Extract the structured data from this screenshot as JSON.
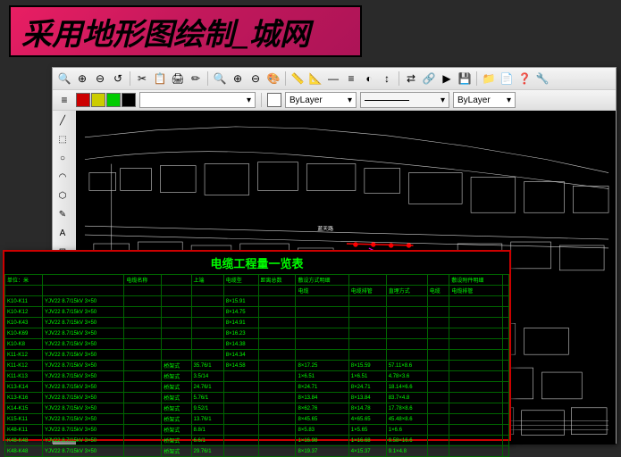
{
  "title": "采用地形图绘制_城网",
  "toolbar_icons": [
    "🔍",
    "⊕",
    "⊖",
    "↺",
    "✂",
    "📋",
    "🖨",
    "✏",
    "🔍",
    "⊕",
    "⊖",
    "🎨",
    "📏",
    "📐",
    "—",
    "≡",
    "◐",
    "↕",
    "⇄",
    "🔗",
    "▶",
    "💾",
    "📁",
    "📄",
    "❓",
    "🔧"
  ],
  "layer_bar": {
    "swatch_colors": [
      "#c00",
      "#cc0",
      "#0c0",
      "#000"
    ],
    "dropdown1": "",
    "bylayer1": "ByLayer",
    "line_dropdown": "",
    "bylayer2": "ByLayer"
  },
  "left_tools": [
    "╱",
    "⬚",
    "○",
    "◠",
    "⬡",
    "✎",
    "A",
    "⊞",
    "◈",
    "⊡",
    "▦",
    "◉",
    "⊟",
    "◫",
    "⬒",
    "⊡"
  ],
  "overlay": {
    "title": "电缆工程量一览表",
    "headers": [
      "单位：米",
      "",
      "电缆名称",
      "",
      "上端",
      "电缆型",
      "距离总数",
      "敷设方式明细",
      "",
      "",
      "",
      "敷设附件明细",
      ""
    ],
    "subheaders": [
      "",
      "",
      "",
      "",
      "",
      "",
      "",
      "电缆",
      "电缆排管",
      "直埋方式",
      "电缆",
      "电缆排管",
      ""
    ],
    "rows": [
      [
        "K10-K11",
        "YJV22 8.7/15kV 3×50",
        "",
        "",
        "",
        "8×15.91",
        "",
        "",
        "",
        "",
        "",
        "",
        ""
      ],
      [
        "K10-K12",
        "YJV22 8.7/15kV 3×50",
        "",
        "",
        "",
        "8×14.75",
        "",
        "",
        "",
        "",
        "",
        "",
        ""
      ],
      [
        "K10-K43",
        "YJV22 8.7/15kV 3×50",
        "",
        "",
        "",
        "8×14.91",
        "",
        "",
        "",
        "",
        "",
        "",
        ""
      ],
      [
        "K10-K69",
        "YJV22 8.7/15kV 3×50",
        "",
        "",
        "",
        "8×16.23",
        "",
        "",
        "",
        "",
        "",
        "",
        ""
      ],
      [
        "K10-K8",
        "YJV22 8.7/15kV 3×50",
        "",
        "",
        "",
        "8×14.38",
        "",
        "",
        "",
        "",
        "",
        "",
        ""
      ],
      [
        "K11-K12",
        "YJV22 8.7/15kV 3×50",
        "",
        "",
        "",
        "8×14.34",
        "",
        "",
        "",
        "",
        "",
        "",
        ""
      ],
      [
        "K11-K12",
        "YJV22 8.7/15kV 3×50",
        "",
        "桥架式",
        "35.76/1",
        "8×14.58",
        "",
        "8×17.25",
        "8×15.59",
        "57.11×8.6",
        "",
        "",
        ""
      ],
      [
        "K11-K13",
        "YJV22 8.7/15kV 3×50",
        "",
        "桥架式",
        "3.5/14",
        "",
        "",
        "1×6.51",
        "1×6.51",
        "4.78×3.6",
        "",
        "",
        ""
      ],
      [
        "K13-K14",
        "YJV22 8.7/15kV 3×50",
        "",
        "桥架式",
        "24.76/1",
        "",
        "",
        "8×24.71",
        "8×24.71",
        "18.14×6.6",
        "",
        "",
        ""
      ],
      [
        "K13-K16",
        "YJV22 8.7/15kV 3×50",
        "",
        "桥架式",
        "5.76/1",
        "",
        "",
        "8×13.84",
        "8×13.84",
        "83.7×4.8",
        "",
        "",
        ""
      ],
      [
        "K14-K15",
        "YJV22 8.7/15kV 3×50",
        "",
        "桥架式",
        "9.52/1",
        "",
        "",
        "8×62.76",
        "8×14.78",
        "17.78×8.6",
        "",
        "",
        ""
      ],
      [
        "K15-K11",
        "YJV22 8.7/15kV 3×50",
        "",
        "桥架式",
        "13.76/1",
        "",
        "",
        "8×45.65",
        "4×65.65",
        "45.48×8.6",
        "",
        "",
        ""
      ],
      [
        "K48-K11",
        "YJV22 8.7/15kV 3×50",
        "",
        "桥架式",
        "8.8/1",
        "",
        "",
        "8×5.83",
        "1×5.65",
        "1×6.6",
        "",
        "",
        ""
      ],
      [
        "K48-K48",
        "YJV22 8.7/15kV 3×50",
        "",
        "桥架式",
        "6.6/1",
        "",
        "",
        "1×16.98",
        "1×16.68",
        "9.58×16.6",
        "",
        "",
        ""
      ],
      [
        "K48-K48",
        "YJV22 8.7/15kV 3×50",
        "",
        "桥架式",
        "29.76/1",
        "",
        "",
        "8×19.37",
        "4×15.37",
        "9.1×4.8",
        "",
        "",
        ""
      ]
    ]
  }
}
